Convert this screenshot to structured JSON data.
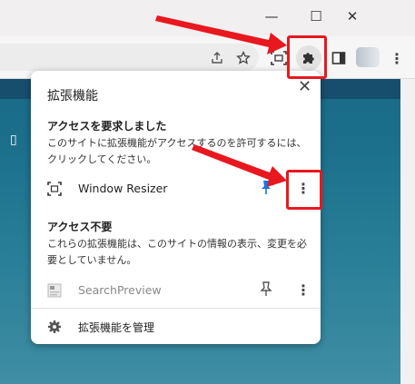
{
  "window": {
    "minimize_glyph": "—",
    "maximize_glyph": "☐",
    "close_glyph": "✕"
  },
  "toolbar": {
    "share_icon": "share-icon",
    "bookmark_icon": "star-icon",
    "resize_icon": "window-resizer-icon",
    "extensions_icon": "puzzle-icon",
    "sidepanel_icon": "side-panel-icon",
    "menu_glyph": "⋮"
  },
  "page": {
    "phone_glyph": "▯"
  },
  "popup": {
    "title": "拡張機能",
    "close_glyph": "✕",
    "section_requested": {
      "heading": "アクセスを要求しました",
      "description": "このサイトに拡張機能がアクセスするのを許可するには、クリックしてください。",
      "extensions": [
        {
          "name": "Window Resizer",
          "icon": "window-resizer-icon",
          "pinned": true,
          "pin_color": "#1a73e8",
          "menu_glyph": "⋮"
        }
      ]
    },
    "section_no_access": {
      "heading": "アクセス不要",
      "description": "これらの拡張機能は、このサイトの情報の表示、変更を必要としていません。",
      "extensions": [
        {
          "name": "SearchPreview",
          "icon": "search-preview-icon",
          "pinned": true,
          "pin_color": "#555555",
          "menu_glyph": "⋮"
        }
      ]
    },
    "manage_label": "拡張機能を管理",
    "manage_icon": "gear-icon"
  },
  "colors": {
    "highlight": "#e8181e",
    "page_background": "#1b6f8b"
  }
}
